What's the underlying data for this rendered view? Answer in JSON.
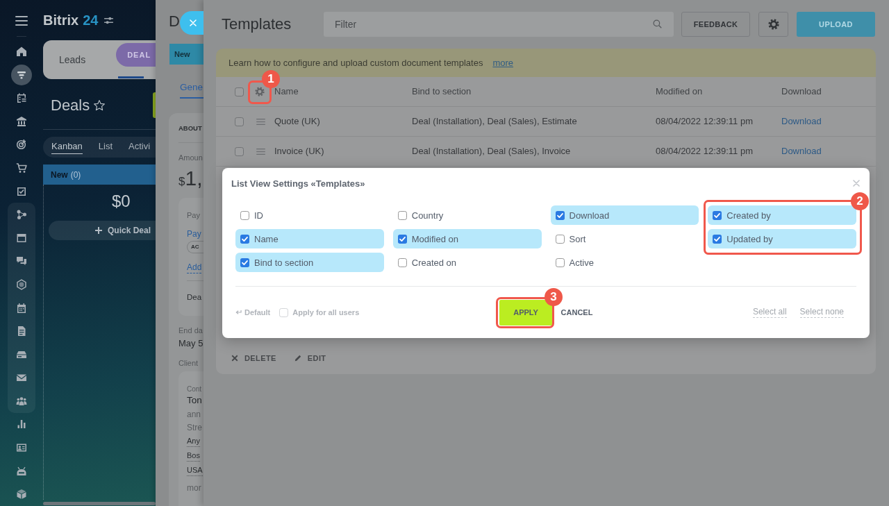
{
  "nav": {
    "top_items": [
      {
        "kind": "home",
        "selected": false
      },
      {
        "kind": "funnel",
        "selected": true
      },
      {
        "kind": "planner",
        "selected": false
      },
      {
        "kind": "building",
        "selected": false
      },
      {
        "kind": "target",
        "selected": false
      },
      {
        "kind": "cart",
        "selected": false
      },
      {
        "kind": "tasks",
        "selected": false
      }
    ],
    "group_items": [
      {
        "kind": "network",
        "selected": false
      },
      {
        "kind": "window",
        "selected": false
      },
      {
        "kind": "chat",
        "selected": false
      },
      {
        "kind": "hexagon",
        "selected": false
      },
      {
        "kind": "calendar",
        "selected": false
      },
      {
        "kind": "document",
        "selected": false
      },
      {
        "kind": "drive",
        "selected": false
      },
      {
        "kind": "mail",
        "selected": false
      },
      {
        "kind": "people",
        "selected": false
      }
    ],
    "bottom_items": [
      {
        "kind": "chart",
        "selected": false
      },
      {
        "kind": "contact",
        "selected": false
      },
      {
        "kind": "robot",
        "selected": false
      },
      {
        "kind": "cube",
        "selected": false
      }
    ]
  },
  "header": {
    "logo_name": "Bitrix",
    "logo_number": "24"
  },
  "crm_tabs": [
    {
      "label": "Leads",
      "selected": false
    },
    {
      "label": "DEAL",
      "selected": true
    }
  ],
  "page_title": "Deals",
  "kanban": {
    "tabs": [
      {
        "label": "Kanban",
        "selected": true
      },
      {
        "label": "List",
        "selected": false
      },
      {
        "label": "Activi",
        "selected": false
      }
    ],
    "column": {
      "title": "New",
      "count": "(0)",
      "total": "$0",
      "button": "Quick Deal"
    }
  },
  "deal_slider": {
    "title": "D",
    "stage": "New",
    "tabs": [
      {
        "label": "Gene",
        "selected": true
      }
    ],
    "section": "ABOUT",
    "amount_label": "Amoun",
    "currency": "$",
    "amount": "1,",
    "payment": {
      "label": "Pay",
      "link": "Pay",
      "status": "AC",
      "add_link": "Add",
      "deal": "Dea"
    },
    "end_date_label": "End da",
    "end_date": "May 5",
    "client_label": "Client",
    "contact": {
      "role_label": "Cont",
      "name": "Ton",
      "email": "ann",
      "address_label": "Stre",
      "address": [
        "Any",
        "Bos",
        "USA"
      ],
      "more": "mor"
    }
  },
  "templates_slider": {
    "title": "Templates",
    "filter": {
      "placeholder": "Filter"
    },
    "buttons": [
      {
        "kind": "text",
        "label": "FEEDBACK"
      },
      {
        "kind": "settings"
      },
      {
        "kind": "primary",
        "label": "UPLOAD"
      }
    ],
    "banner": {
      "text": "Learn how to configure and upload custom document templates",
      "link": "more"
    },
    "table": {
      "select_all_checked": false,
      "columns": [
        "Name",
        "Bind to section",
        "Modified on",
        "Download"
      ],
      "rows": [
        {
          "checked": false,
          "name": "Quote (UK)",
          "bind_to_section": "Deal (Installation), Deal (Sales), Estimate",
          "modified_on": "08/04/2022 12:39:11 pm",
          "download": "Download"
        },
        {
          "checked": false,
          "name": "Invoice (UK)",
          "bind_to_section": "Deal (Installation), Deal (Sales), Invoice",
          "modified_on": "08/04/2022 12:39:11 pm",
          "download": "Download"
        }
      ]
    },
    "actions": [
      {
        "kind": "delete",
        "label": "DELETE",
        "disabled": true
      },
      {
        "kind": "edit",
        "label": "EDIT",
        "disabled": true
      }
    ]
  },
  "dialog": {
    "title": "List View Settings «Templates»",
    "fields": [
      {
        "label": "ID",
        "checked": false
      },
      {
        "label": "Country",
        "checked": false
      },
      {
        "label": "Download",
        "checked": true
      },
      {
        "label": "Created by",
        "checked": true
      },
      {
        "label": "Name",
        "checked": true
      },
      {
        "label": "Modified on",
        "checked": true
      },
      {
        "label": "Sort",
        "checked": false
      },
      {
        "label": "Updated by",
        "checked": true
      },
      {
        "label": "Bind to section",
        "checked": true
      },
      {
        "label": "Created on",
        "checked": false
      },
      {
        "label": "Active",
        "checked": false
      }
    ],
    "default_link": "Default",
    "apply_all": {
      "label": "Apply for all users",
      "checked": false
    },
    "buttons": [
      {
        "kind": "apply",
        "label": "APPLY"
      },
      {
        "kind": "cancel",
        "label": "CANCEL"
      }
    ],
    "select_all": "Select all",
    "select_none": "Select none"
  },
  "callouts": [
    {
      "number": "1"
    },
    {
      "number": "2"
    },
    {
      "number": "3"
    }
  ]
}
